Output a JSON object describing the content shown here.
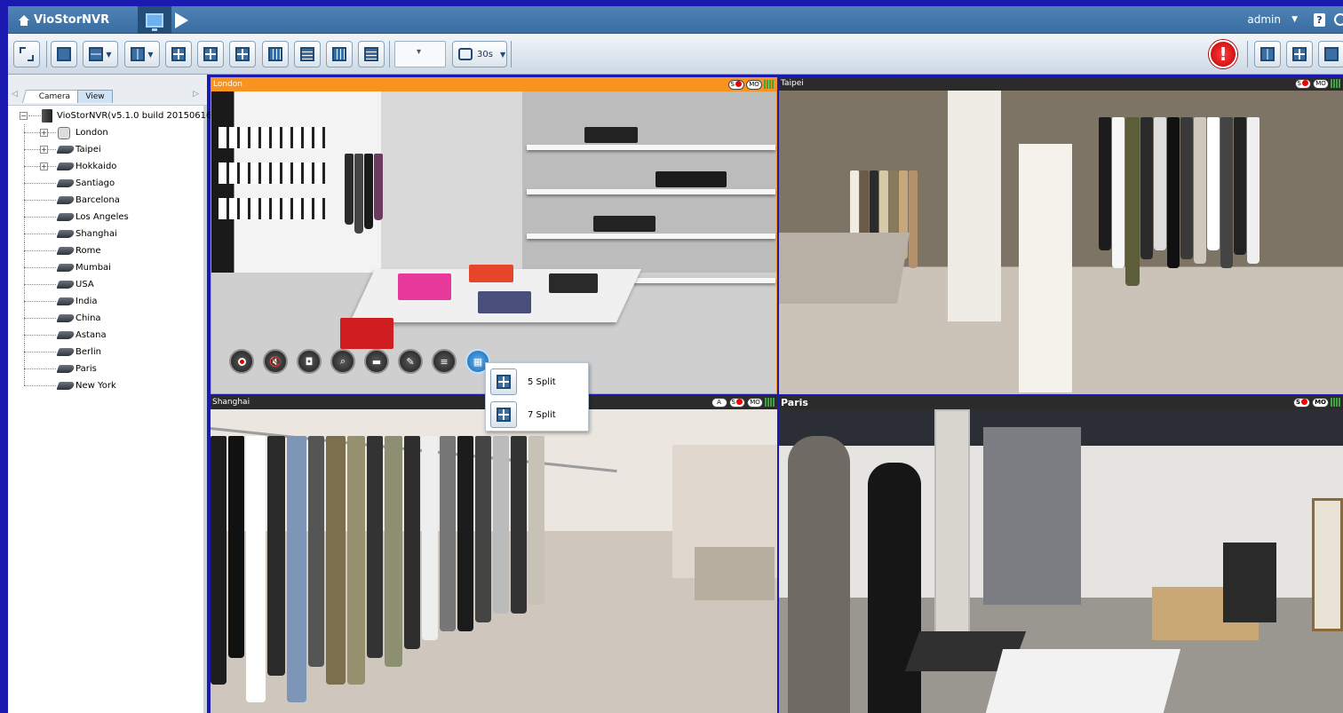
{
  "app": {
    "title": "VioStorNVR",
    "user": "admin",
    "help": "?"
  },
  "toolbar": {
    "sequence_interval": "30s",
    "alert_glyph": "!"
  },
  "panel": {
    "tabs": [
      {
        "label": "Camera"
      },
      {
        "label": "View"
      }
    ],
    "active_tab": "View",
    "root": "VioStorNVR(v5.1.0 build 20150616)",
    "cameras": [
      {
        "label": "London",
        "expandable": true,
        "icon": "dome-camera-icon"
      },
      {
        "label": "Taipei",
        "expandable": true,
        "icon": "camera-icon"
      },
      {
        "label": "Hokkaido",
        "expandable": true,
        "icon": "camera-icon"
      },
      {
        "label": "Santiago",
        "expandable": false,
        "icon": "camera-icon"
      },
      {
        "label": "Barcelona",
        "expandable": false,
        "icon": "camera-icon"
      },
      {
        "label": "Los Angeles",
        "expandable": false,
        "icon": "camera-icon"
      },
      {
        "label": "Shanghai",
        "expandable": false,
        "icon": "camera-icon"
      },
      {
        "label": "Rome",
        "expandable": false,
        "icon": "camera-icon"
      },
      {
        "label": "Mumbai",
        "expandable": false,
        "icon": "camera-icon"
      },
      {
        "label": "USA",
        "expandable": false,
        "icon": "camera-icon"
      },
      {
        "label": "India",
        "expandable": false,
        "icon": "camera-icon"
      },
      {
        "label": "China",
        "expandable": false,
        "icon": "camera-icon"
      },
      {
        "label": "Astana",
        "expandable": false,
        "icon": "camera-icon"
      },
      {
        "label": "Berlin",
        "expandable": false,
        "icon": "camera-icon"
      },
      {
        "label": "Paris",
        "expandable": false,
        "icon": "camera-icon"
      },
      {
        "label": "New York",
        "expandable": false,
        "icon": "camera-icon"
      }
    ]
  },
  "channels": {
    "london": {
      "name": "London",
      "header_color": "#f7931e",
      "badges": [
        "S",
        "MO"
      ]
    },
    "taipei": {
      "name": "Taipei",
      "header_color": "#2b2b2b",
      "badges": [
        "S",
        "MO"
      ]
    },
    "shanghai": {
      "name": "Shanghai",
      "header_color": "#2b2b2b",
      "badges": [
        "A",
        "S",
        "MO"
      ]
    },
    "paris": {
      "name": "Paris",
      "header_color": "#2b2b2b",
      "badges": [
        "S",
        "MO"
      ]
    }
  },
  "split_menu": {
    "items": [
      {
        "label": "5 Split"
      },
      {
        "label": "7 Split"
      }
    ]
  },
  "colors": {
    "background": "#1a1ab0",
    "accent": "#f7931e",
    "alert": "#d00000"
  }
}
